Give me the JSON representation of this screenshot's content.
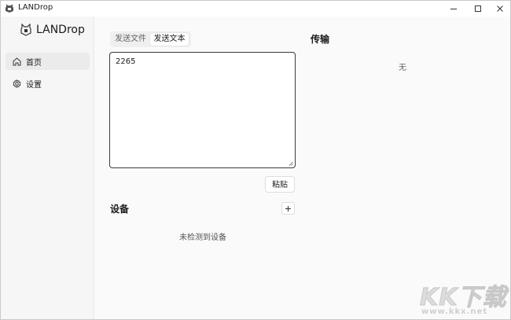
{
  "window": {
    "title": "LANDrop"
  },
  "sidebar": {
    "brand": "LANDrop",
    "items": [
      {
        "label": "首页",
        "icon": "home-icon",
        "active": true
      },
      {
        "label": "设置",
        "icon": "gear-icon",
        "active": false
      }
    ]
  },
  "send": {
    "tabs": [
      {
        "label": "发送文件",
        "active": false
      },
      {
        "label": "发送文本",
        "active": true
      }
    ],
    "text_value": "2265",
    "paste_label": "粘贴"
  },
  "devices": {
    "title": "设备",
    "add_icon": "plus-icon",
    "empty_text": "未检测到设备"
  },
  "transfers": {
    "title": "传输",
    "empty_text": "无"
  },
  "watermark": {
    "big": "KK下载",
    "small": "www.kkx.net"
  },
  "colors": {
    "background": "#fafafa",
    "sidebar_bg": "#f6f6f6",
    "active_nav": "#ebebeb",
    "text": "#1b1b1b",
    "muted": "#666666"
  }
}
